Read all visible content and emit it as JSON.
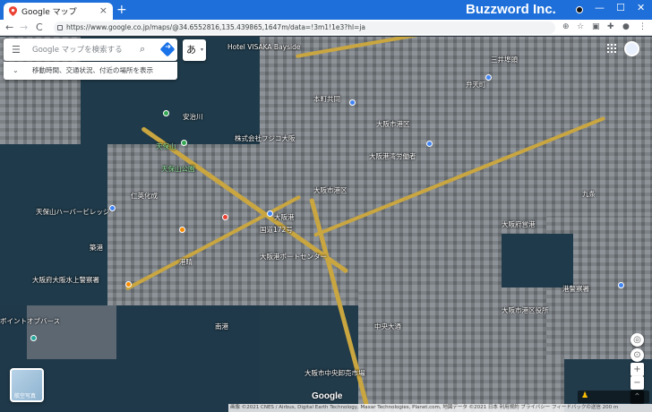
{
  "browser": {
    "tab_title": "Google マップ",
    "tab_close": "×",
    "new_tab": "+",
    "brand": "Buzzword Inc.",
    "window_controls": [
      "—",
      "☐",
      "✕"
    ],
    "nav": {
      "back": "←",
      "forward": "→",
      "reload": "C"
    },
    "url": "https://www.google.co.jp/maps/@34.6552816,135.439865,1647m/data=!3m1!1e3?hl=ja"
  },
  "search": {
    "placeholder": "Google マップを検索する",
    "hint": "移動時間、交通状況、付近の場所を表示",
    "ime_label": "あ"
  },
  "map_labels": [
    "Hotel VISAKA Bayside",
    "三井埠頭",
    "本町共同",
    "安治川",
    "天保山公園",
    "天保山",
    "株式会社フジコ大阪",
    "仁英化成",
    "天保山ハーバービレッジ",
    "大阪府大阪水上警察署",
    "築港",
    "南港",
    "大阪港",
    "大阪市港区",
    "ボイントオブバース",
    "港晴",
    "弁天町",
    "大阪港湾労働者",
    "大阪府営港",
    "大阪港ポートセンター",
    "中央大通",
    "大阪市港区",
    "大阪市中央卸売市場",
    "港警察署",
    "九条",
    "大阪市港区役所",
    "国道172号"
  ],
  "controls": {
    "layer_label": "航空写真",
    "google_logo": "Google",
    "zoom_in": "+",
    "zoom_out": "−",
    "expand": "⌃",
    "attribution": "画像 ©2021 CNES / Airbus, Digital Earth Technology, Maxar Technologies, Planet.com, 地図データ ©2021   日本   利用規約   プライバシー   フィードバックの送信   200 m"
  },
  "colors": {
    "titlebar": "#1e6fd9",
    "roads": "#c9a640",
    "water": "#1f3a4a"
  }
}
